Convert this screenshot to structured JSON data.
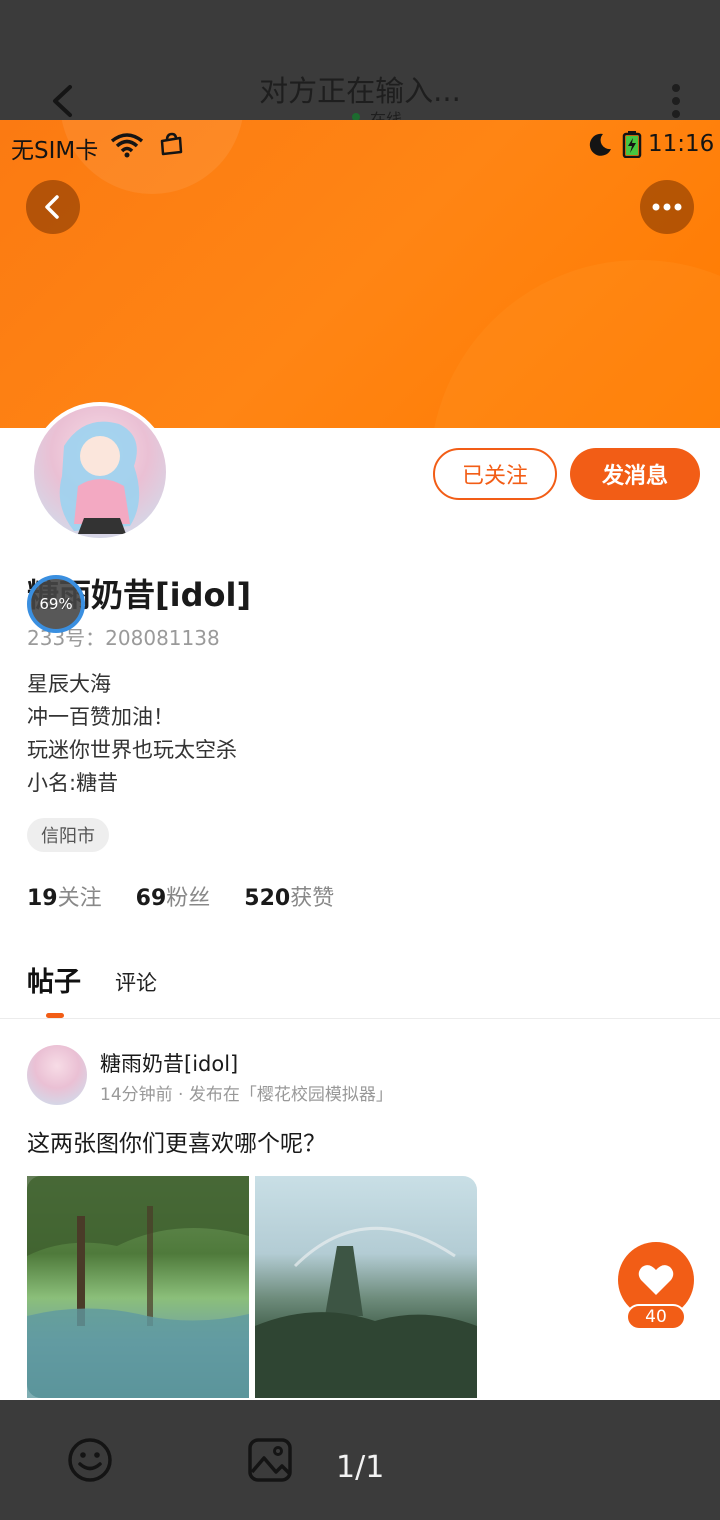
{
  "chat_header": {
    "title": "对方正在输入...",
    "online_label": "在线",
    "back_icon": "chevron-left-icon",
    "more_icon": "vertical-dots-icon"
  },
  "status_bar": {
    "carrier": "无SIM卡",
    "time": "11:16",
    "icons": [
      "wifi-icon",
      "bag-icon",
      "moon-icon",
      "battery-charging-icon"
    ]
  },
  "profile": {
    "banner_color": "#ff8514",
    "accent_color": "#f25d16",
    "username": "糖雨奶昔[idol]",
    "uid_label": "233号：208081138",
    "loading_progress": "69%",
    "bio_lines": [
      "星辰大海",
      "冲一百赞加油！",
      "玩迷你世界也玩太空杀",
      "小名:糖昔"
    ],
    "location": "信阳市",
    "buttons": {
      "followed": "已关注",
      "message": "发消息"
    },
    "stats": [
      {
        "value": "19",
        "label": "关注"
      },
      {
        "value": "69",
        "label": "粉丝"
      },
      {
        "value": "520",
        "label": "获赞"
      }
    ]
  },
  "tabs": [
    {
      "label": "帖子",
      "active": true
    },
    {
      "label": "评论",
      "active": false
    }
  ],
  "post": {
    "author": "糖雨奶昔[idol]",
    "meta": "14分钟前 · 发布在「樱花校园模拟器」",
    "text": "这两张图你们更喜欢哪个呢？",
    "likes": "40"
  },
  "viewer": {
    "page_indicator": "1/1",
    "icons": [
      "emoji-icon",
      "image-icon"
    ]
  }
}
